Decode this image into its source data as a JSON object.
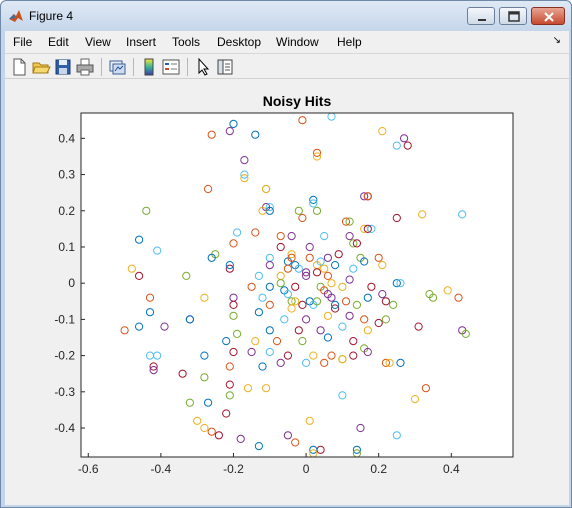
{
  "window": {
    "title": "Figure 4"
  },
  "menu": [
    "File",
    "Edit",
    "View",
    "Insert",
    "Tools",
    "Desktop",
    "Window",
    "Help"
  ],
  "menu_overflow": "↘",
  "toolbar": [
    "new-figure-icon",
    "open-file-icon",
    "save-icon",
    "print-icon",
    "link-plot-icon",
    "insert-colorbar-icon",
    "insert-legend-icon",
    "pointer-icon",
    "plot-browser-icon"
  ],
  "chart_data": {
    "type": "scatter",
    "title": "Noisy Hits",
    "xlabel": "",
    "ylabel": "",
    "xlim": [
      -0.62,
      0.57
    ],
    "ylim": [
      -0.48,
      0.47
    ],
    "xticks": [
      "-0.6",
      "-0.4",
      "-0.2",
      "0",
      "0.2",
      "0.4"
    ],
    "yticks": [
      "0.4",
      "0.3",
      "0.2",
      "0.1",
      "0",
      "-0.1",
      "-0.2",
      "-0.3",
      "-0.4"
    ],
    "marker": "open-circle",
    "grid": false,
    "legend": "none",
    "colors": [
      "#0072bd",
      "#d95319",
      "#edb120",
      "#7e2f8e",
      "#77ac30",
      "#4dbeee",
      "#a2142f"
    ],
    "points": [
      [
        -0.01,
        0.45,
        1
      ],
      [
        0.07,
        0.46,
        5
      ],
      [
        -0.2,
        0.44,
        0
      ],
      [
        -0.21,
        0.42,
        3
      ],
      [
        -0.26,
        0.41,
        1
      ],
      [
        -0.14,
        0.41,
        0
      ],
      [
        0.21,
        0.42,
        2
      ],
      [
        0.27,
        0.4,
        3
      ],
      [
        0.28,
        0.38,
        6
      ],
      [
        0.25,
        0.38,
        5
      ],
      [
        0.03,
        0.36,
        1
      ],
      [
        0.03,
        0.35,
        2
      ],
      [
        -0.17,
        0.34,
        3
      ],
      [
        -0.17,
        0.3,
        5
      ],
      [
        -0.17,
        0.29,
        2
      ],
      [
        -0.27,
        0.26,
        1
      ],
      [
        -0.11,
        0.26,
        4
      ],
      [
        -0.11,
        0.26,
        2
      ],
      [
        0.16,
        0.24,
        3
      ],
      [
        0.17,
        0.24,
        6
      ],
      [
        0.17,
        0.24,
        1
      ],
      [
        0.02,
        0.23,
        0
      ],
      [
        0.02,
        0.22,
        5
      ],
      [
        -0.11,
        0.21,
        3
      ],
      [
        -0.1,
        0.21,
        5
      ],
      [
        -0.1,
        0.2,
        0
      ],
      [
        -0.12,
        0.2,
        2
      ],
      [
        -0.02,
        0.2,
        4
      ],
      [
        0.03,
        0.2,
        4
      ],
      [
        -0.44,
        0.2,
        4
      ],
      [
        0.32,
        0.19,
        2
      ],
      [
        0.43,
        0.19,
        5
      ],
      [
        -0.01,
        0.18,
        1
      ],
      [
        0.25,
        0.18,
        6
      ],
      [
        0.12,
        0.17,
        4
      ],
      [
        0.11,
        0.17,
        1
      ],
      [
        0.16,
        0.15,
        2
      ],
      [
        0.18,
        0.15,
        5
      ],
      [
        0.17,
        0.15,
        6
      ],
      [
        -0.19,
        0.14,
        5
      ],
      [
        -0.14,
        0.14,
        1
      ],
      [
        -0.07,
        0.13,
        1
      ],
      [
        -0.04,
        0.13,
        3
      ],
      [
        0.05,
        0.13,
        5
      ],
      [
        0.12,
        0.13,
        3
      ],
      [
        -0.46,
        0.12,
        0
      ],
      [
        -0.2,
        0.11,
        1
      ],
      [
        -0.07,
        0.1,
        6
      ],
      [
        0.01,
        0.1,
        3
      ],
      [
        0.13,
        0.11,
        4
      ],
      [
        0.14,
        0.11,
        6
      ],
      [
        -0.41,
        0.09,
        5
      ],
      [
        -0.25,
        0.08,
        4
      ],
      [
        -0.26,
        0.07,
        0
      ],
      [
        -0.1,
        0.07,
        5
      ],
      [
        -0.04,
        0.08,
        2
      ],
      [
        0.01,
        0.07,
        1
      ],
      [
        0.06,
        0.07,
        3
      ],
      [
        0.09,
        0.08,
        6
      ],
      [
        0.15,
        0.07,
        4
      ],
      [
        0.2,
        0.07,
        1
      ],
      [
        -0.21,
        0.04,
        6
      ],
      [
        -0.21,
        0.05,
        0
      ],
      [
        -0.1,
        0.05,
        3
      ],
      [
        -0.05,
        0.06,
        0
      ],
      [
        0.03,
        0.05,
        2
      ],
      [
        0.08,
        0.05,
        0
      ],
      [
        0.13,
        0.04,
        5
      ],
      [
        0.16,
        0.06,
        0
      ],
      [
        0.21,
        0.05,
        2
      ],
      [
        -0.48,
        0.04,
        2
      ],
      [
        -0.46,
        0.02,
        6
      ],
      [
        -0.33,
        0.02,
        4
      ],
      [
        -0.13,
        0.02,
        5
      ],
      [
        -0.07,
        0.02,
        2
      ],
      [
        0.0,
        0.02,
        3
      ],
      [
        0.06,
        0.02,
        1
      ],
      [
        0.12,
        0.01,
        3
      ],
      [
        0.25,
        0.0,
        0
      ],
      [
        0.26,
        0.0,
        5
      ],
      [
        -0.15,
        -0.01,
        1
      ],
      [
        -0.1,
        -0.01,
        0
      ],
      [
        -0.03,
        -0.01,
        6
      ],
      [
        0.04,
        -0.01,
        4
      ],
      [
        0.1,
        -0.01,
        2
      ],
      [
        0.18,
        -0.01,
        6
      ],
      [
        0.39,
        -0.02,
        2
      ],
      [
        -0.43,
        -0.04,
        1
      ],
      [
        -0.28,
        -0.04,
        2
      ],
      [
        -0.2,
        -0.04,
        3
      ],
      [
        -0.12,
        -0.04,
        5
      ],
      [
        -0.04,
        -0.05,
        4
      ],
      [
        0.01,
        -0.05,
        0
      ],
      [
        0.07,
        -0.04,
        3
      ],
      [
        0.11,
        -0.05,
        1
      ],
      [
        0.17,
        -0.04,
        0
      ],
      [
        0.21,
        -0.03,
        3
      ],
      [
        0.35,
        -0.04,
        4
      ],
      [
        0.34,
        -0.03,
        4
      ],
      [
        0.42,
        -0.04,
        1
      ],
      [
        -0.2,
        -0.06,
        6
      ],
      [
        -0.1,
        -0.06,
        1
      ],
      [
        -0.04,
        -0.07,
        2
      ],
      [
        0.02,
        -0.06,
        5
      ],
      [
        0.08,
        -0.07,
        6
      ],
      [
        0.14,
        -0.06,
        4
      ],
      [
        0.22,
        -0.05,
        6
      ],
      [
        0.24,
        -0.06,
        4
      ],
      [
        -0.43,
        -0.08,
        0
      ],
      [
        -0.32,
        -0.1,
        3
      ],
      [
        -0.32,
        -0.1,
        0
      ],
      [
        -0.2,
        -0.09,
        4
      ],
      [
        -0.13,
        -0.08,
        0
      ],
      [
        -0.06,
        -0.1,
        5
      ],
      [
        0.0,
        -0.1,
        3
      ],
      [
        0.06,
        -0.09,
        2
      ],
      [
        0.12,
        -0.09,
        3
      ],
      [
        0.16,
        -0.1,
        1
      ],
      [
        0.2,
        -0.11,
        6
      ],
      [
        0.22,
        -0.1,
        4
      ],
      [
        -0.5,
        -0.13,
        1
      ],
      [
        -0.46,
        -0.12,
        0
      ],
      [
        -0.39,
        -0.12,
        3
      ],
      [
        -0.19,
        -0.14,
        4
      ],
      [
        -0.1,
        -0.13,
        0
      ],
      [
        -0.02,
        -0.13,
        6
      ],
      [
        0.04,
        -0.13,
        3
      ],
      [
        0.1,
        -0.12,
        5
      ],
      [
        0.17,
        -0.13,
        2
      ],
      [
        0.31,
        -0.12,
        6
      ],
      [
        0.43,
        -0.13,
        3
      ],
      [
        0.44,
        -0.14,
        4
      ],
      [
        -0.22,
        -0.16,
        0
      ],
      [
        -0.14,
        -0.16,
        2
      ],
      [
        -0.08,
        -0.16,
        1
      ],
      [
        -0.01,
        -0.16,
        4
      ],
      [
        0.06,
        -0.15,
        0
      ],
      [
        0.13,
        -0.16,
        6
      ],
      [
        0.16,
        -0.18,
        4
      ],
      [
        -0.43,
        -0.2,
        5
      ],
      [
        -0.41,
        -0.2,
        5
      ],
      [
        -0.28,
        -0.2,
        0
      ],
      [
        -0.2,
        -0.19,
        6
      ],
      [
        -0.15,
        -0.19,
        3
      ],
      [
        -0.1,
        -0.19,
        5
      ],
      [
        -0.05,
        -0.2,
        6
      ],
      [
        0.02,
        -0.2,
        2
      ],
      [
        0.07,
        -0.2,
        1
      ],
      [
        0.1,
        -0.21,
        4
      ],
      [
        0.17,
        -0.19,
        3
      ],
      [
        -0.42,
        -0.23,
        6
      ],
      [
        -0.42,
        -0.24,
        3
      ],
      [
        -0.34,
        -0.25,
        6
      ],
      [
        -0.21,
        -0.23,
        1
      ],
      [
        -0.12,
        -0.23,
        0
      ],
      [
        -0.07,
        -0.22,
        3
      ],
      [
        0.0,
        -0.22,
        5
      ],
      [
        0.05,
        -0.22,
        1
      ],
      [
        0.1,
        -0.21,
        2
      ],
      [
        0.13,
        -0.2,
        6
      ],
      [
        0.22,
        -0.22,
        1
      ],
      [
        0.23,
        -0.22,
        2
      ],
      [
        0.26,
        -0.22,
        0
      ],
      [
        -0.28,
        -0.26,
        4
      ],
      [
        -0.21,
        -0.28,
        6
      ],
      [
        -0.16,
        -0.29,
        2
      ],
      [
        -0.11,
        -0.29,
        2
      ],
      [
        0.33,
        -0.29,
        1
      ],
      [
        0.3,
        -0.32,
        2
      ],
      [
        -0.32,
        -0.33,
        4
      ],
      [
        -0.21,
        -0.31,
        4
      ],
      [
        0.1,
        -0.31,
        5
      ],
      [
        -0.27,
        -0.33,
        0
      ],
      [
        -0.22,
        -0.36,
        6
      ],
      [
        -0.3,
        -0.38,
        2
      ],
      [
        -0.28,
        -0.4,
        2
      ],
      [
        -0.26,
        -0.41,
        1
      ],
      [
        0.01,
        -0.38,
        2
      ],
      [
        0.15,
        -0.4,
        3
      ],
      [
        0.25,
        -0.42,
        5
      ],
      [
        -0.24,
        -0.42,
        6
      ],
      [
        -0.18,
        -0.43,
        3
      ],
      [
        -0.05,
        -0.42,
        3
      ],
      [
        -0.03,
        -0.44,
        1
      ],
      [
        -0.13,
        -0.45,
        0
      ],
      [
        0.04,
        -0.46,
        6
      ],
      [
        0.02,
        -0.46,
        0
      ],
      [
        0.02,
        -0.47,
        2
      ],
      [
        0.14,
        -0.46,
        0
      ],
      [
        0.14,
        -0.47,
        4
      ],
      [
        -0.05,
        0.04,
        1
      ],
      [
        -0.03,
        0.05,
        0
      ],
      [
        -0.02,
        0.04,
        5
      ],
      [
        0.0,
        0.03,
        3
      ],
      [
        0.03,
        0.03,
        6
      ],
      [
        0.05,
        0.04,
        2
      ],
      [
        -0.06,
        -0.02,
        0
      ],
      [
        -0.05,
        -0.03,
        5
      ],
      [
        0.05,
        -0.02,
        1
      ],
      [
        0.06,
        -0.03,
        3
      ],
      [
        0.03,
        -0.05,
        4
      ],
      [
        -0.01,
        -0.06,
        6
      ],
      [
        -0.03,
        -0.05,
        2
      ],
      [
        0.07,
        0.0,
        2
      ],
      [
        -0.07,
        0.0,
        4
      ],
      [
        0.04,
        0.06,
        5
      ],
      [
        -0.04,
        0.07,
        1
      ],
      [
        0.08,
        -0.06,
        0
      ]
    ]
  }
}
